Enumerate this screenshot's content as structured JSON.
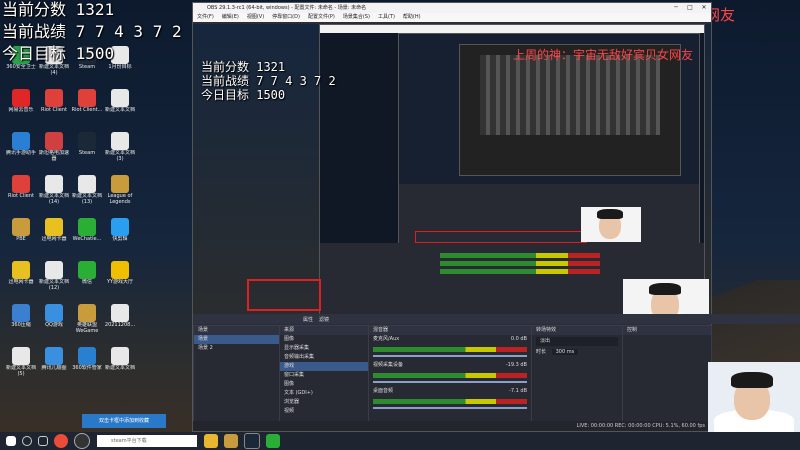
{
  "overlay": {
    "line1": "当前分数 1321",
    "line2": "当前战绩 7 7 4 3 7 2",
    "line3": "今日目标 1500"
  },
  "banner": {
    "text": "上周的神：宇宙无敌好宾贝女网友",
    "color": "#ff4444"
  },
  "desktop_icons": [
    {
      "label": "360安全卫士",
      "color": "#2aa14a"
    },
    {
      "label": "新建文本文档(4)",
      "color": "#e8e8e8"
    },
    {
      "label": "Steam",
      "color": "#1b2838"
    },
    {
      "label": "1月份目标",
      "color": "#e8e8e8"
    },
    {
      "label": "网易云音乐",
      "color": "#e02626"
    },
    {
      "label": "Riot Client",
      "color": "#e0403a"
    },
    {
      "label": "Riot Client...",
      "color": "#e0403a"
    },
    {
      "label": "新建文本文档",
      "color": "#e8e8e8"
    },
    {
      "label": "腾讯手游助手",
      "color": "#2a7fd4"
    },
    {
      "label": "斯坦格电加速器",
      "color": "#d04040"
    },
    {
      "label": "Steam",
      "color": "#1b2838"
    },
    {
      "label": "新建文本文档(3)",
      "color": "#e8e8e8"
    },
    {
      "label": "Riot Client",
      "color": "#e0403a"
    },
    {
      "label": "新建文本文档(14)",
      "color": "#e8e8e8"
    },
    {
      "label": "新建文本文档(13)",
      "color": "#e8e8e8"
    },
    {
      "label": "League of Legends",
      "color": "#c89b3c"
    },
    {
      "label": "PBE",
      "color": "#c89b3c"
    },
    {
      "label": "迅电网卡器",
      "color": "#e8c020"
    },
    {
      "label": "WeChatle...",
      "color": "#2bae36"
    },
    {
      "label": "快剪辑",
      "color": "#2a9ef0"
    },
    {
      "label": "迅电网卡器",
      "color": "#e8c020"
    },
    {
      "label": "新建文本文档(12)",
      "color": "#e8e8e8"
    },
    {
      "label": "微信",
      "color": "#2bae36"
    },
    {
      "label": "YY游戏大厅",
      "color": "#f0c000"
    },
    {
      "label": "360压缩",
      "color": "#3a7fd0"
    },
    {
      "label": "QQ游戏",
      "color": "#3a90e0"
    },
    {
      "label": "英雄联盟WeGame",
      "color": "#c89b3c"
    },
    {
      "label": "20211208...",
      "color": "#e8e8e8"
    },
    {
      "label": "新建文本文档(5)",
      "color": "#e8e8e8"
    },
    {
      "label": "腾讯儿顺图",
      "color": "#3a90e0"
    },
    {
      "label": "360软件管家",
      "color": "#2a80d0"
    },
    {
      "label": "新建文本文档",
      "color": "#e8e8e8"
    }
  ],
  "obs": {
    "title": "OBS 29.1.3-rc1 (64-bit, windows) - 配置文件: 未命名 - 场景: 未命名",
    "menu": [
      "文件(F)",
      "编辑(E)",
      "视图(V)",
      "停靠窗口(D)",
      "配置文件(P)",
      "场景集合(S)",
      "工具(T)",
      "帮助(H)"
    ],
    "scenes_header": "场景",
    "scenes": [
      "场景",
      "场景 2"
    ],
    "sources_header": "来源",
    "sources": [
      "图像",
      "显示器采集",
      "音频输出采集",
      "游戏",
      "窗口采集",
      "图像",
      "文本 (GDI+)",
      "浏览器",
      "视频"
    ],
    "mixer_header": "混音器",
    "mixer_channels": [
      {
        "name": "麦克风/Aux",
        "db": "0.0 dB"
      },
      {
        "name": "视频采集设备",
        "db": "-19.3 dB"
      },
      {
        "name": "桌面音频",
        "db": "-7.1 dB"
      }
    ],
    "transitions_header": "转场特效",
    "transition_value": "淡出",
    "duration_label": "时长",
    "duration_value": "300 ms",
    "controls_header": "控制",
    "properties_label": "属性",
    "filters_label": "滤镜",
    "status": "LIVE: 00:00:00   REC: 00:00:00   CPU: 5.1%, 60.00 fps"
  },
  "notification": {
    "text": "双击卡框中添加到收藏"
  },
  "taskbar": {
    "search_placeholder": "steam平台下载",
    "time": "",
    "icons": [
      "start-icon",
      "search-icon",
      "taskview-icon",
      "chrome-icon",
      "obs-icon",
      "folder-icon",
      "lol-icon",
      "steam-icon",
      "wechat-icon"
    ]
  }
}
